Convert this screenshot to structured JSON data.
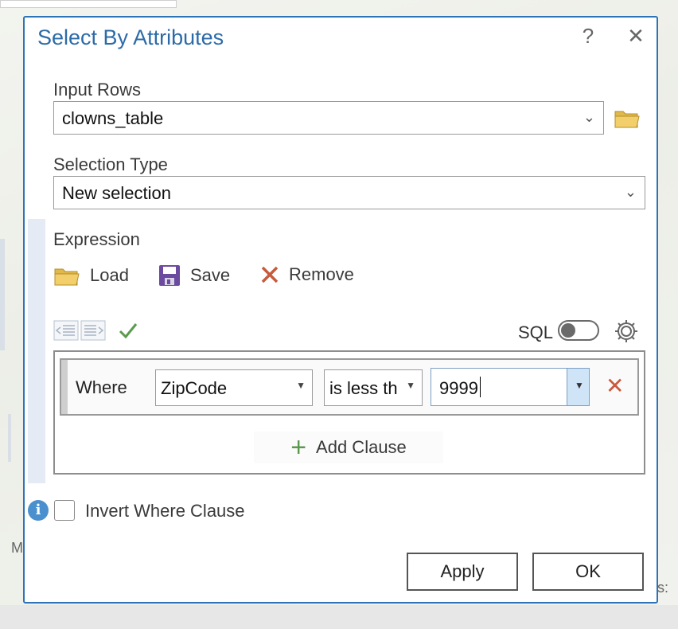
{
  "dialog": {
    "title": "Select By Attributes",
    "help_icon": "?",
    "close_icon": "✕"
  },
  "input_rows": {
    "label": "Input Rows",
    "value": "clowns_table"
  },
  "selection_type": {
    "label": "Selection Type",
    "value": "New selection"
  },
  "expression": {
    "label": "Expression",
    "load_label": "Load",
    "save_label": "Save",
    "remove_label": "Remove",
    "sql_label": "SQL"
  },
  "clause": {
    "where_label": "Where",
    "field": "ZipCode",
    "operator": "is less th",
    "value": "9999"
  },
  "add_clause_label": "Add Clause",
  "invert_label": "Invert Where Clause",
  "buttons": {
    "apply": "Apply",
    "ok": "OK"
  },
  "map": {
    "partial_left": "M",
    "partial_right": "s:"
  },
  "colors": {
    "title": "#2c6ba8",
    "border": "#2c73b8",
    "remove": "#c85a3c",
    "verify": "#5b9a4e"
  }
}
